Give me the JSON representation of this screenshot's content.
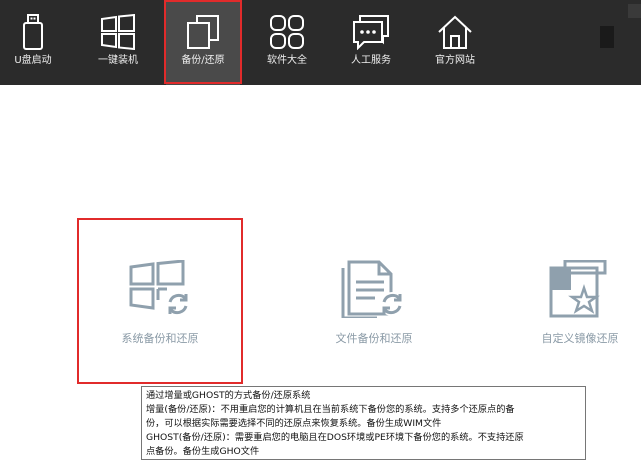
{
  "nav": {
    "items": [
      {
        "label": "U盘启动",
        "icon": "usb-drive-icon"
      },
      {
        "label": "一键装机",
        "icon": "windows-icon"
      },
      {
        "label": "备份/还原",
        "icon": "copy-icon"
      },
      {
        "label": "软件大全",
        "icon": "grid-apps-icon"
      },
      {
        "label": "人工服务",
        "icon": "chat-icon"
      },
      {
        "label": "官方网站",
        "icon": "home-icon"
      }
    ],
    "active_index": 2
  },
  "cards": [
    {
      "label": "系统备份和还原",
      "icon": "windows-restore-icon"
    },
    {
      "label": "文件备份和还原",
      "icon": "document-restore-icon"
    },
    {
      "label": "自定义镜像还原",
      "icon": "custom-image-star-icon"
    }
  ],
  "tooltip": {
    "lines": [
      "通过增量或GHOST的方式备份/还原系统",
      "增量(备份/还原)：不用重启您的计算机且在当前系统下备份您的系统。支持多个还原点的备",
      "份，可以根据实际需要选择不同的还原点来恢复系统。备份生成WIM文件",
      "GHOST(备份/还原)：需要重启您的电脑且在DOS环境或PE环境下备份您的系统。不支持还原",
      "点备份。备份生成GHO文件"
    ]
  },
  "colors": {
    "topbar": "#2b2b2b",
    "active_tab": "#4a4a4a",
    "highlight_border": "#e12b2b",
    "card_icon": "#8fa0ad"
  }
}
